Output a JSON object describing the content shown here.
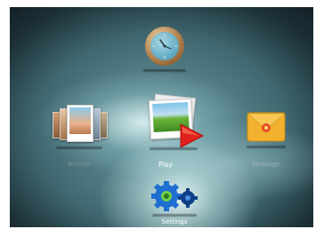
{
  "menu": {
    "items": [
      {
        "id": "clock",
        "label": "Clock",
        "icon": "clock-icon"
      },
      {
        "id": "browse",
        "label": "Browse",
        "icon": "photo-stack-icon"
      },
      {
        "id": "play",
        "label": "Play",
        "icon": "play-slideshow-icon",
        "selected": true
      },
      {
        "id": "message",
        "label": "Message",
        "icon": "envelope-icon"
      },
      {
        "id": "settings",
        "label": "Settings",
        "icon": "gears-icon"
      }
    ]
  },
  "colors": {
    "background_dark": "#1d3138",
    "background_light": "#d8f0f0",
    "play_accent": "#e0201c",
    "envelope": "#f2b12e",
    "gear_blue": "#1f6fd1",
    "label_selected": "#ffffff",
    "label_dim": "#9fb3b8"
  }
}
